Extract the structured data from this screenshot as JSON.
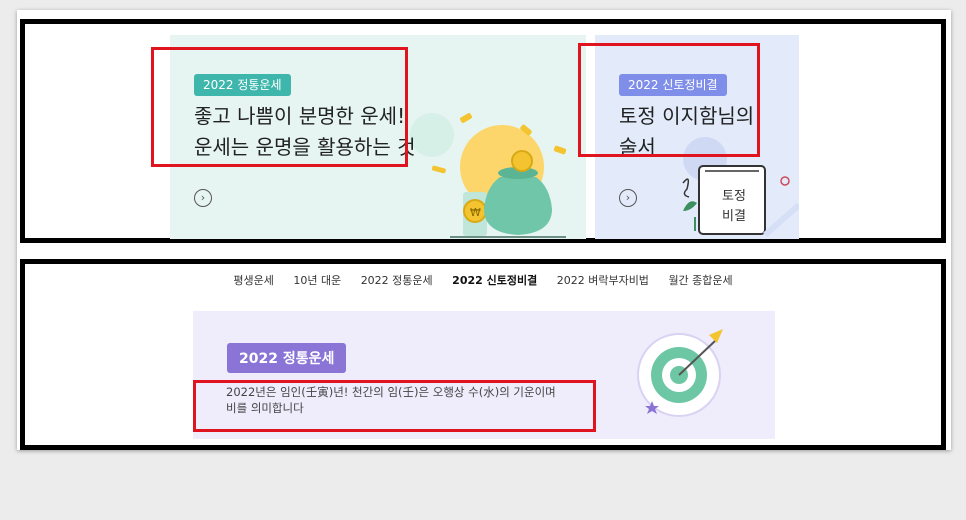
{
  "top_banner": {
    "left_card": {
      "badge": "2022 정통운세",
      "line1": "좋고 나쁨이 분명한 운세!",
      "line2": "운세는 운명을 활용하는 것",
      "arrow": "›"
    },
    "right_card": {
      "badge": "2022 신토정비결",
      "line1": "토정 이지함님의",
      "line2": "술서",
      "book_text_1": "토정",
      "book_text_2": "비결",
      "arrow": "›"
    }
  },
  "nav": {
    "tabs": [
      {
        "label": "평생운세"
      },
      {
        "label": "10년 대운"
      },
      {
        "label": "2022 정통운세"
      },
      {
        "label": "2022 신토정비결"
      },
      {
        "label": "2022 벼락부자비법"
      },
      {
        "label": "월간 종합운세"
      }
    ],
    "active_index": 3
  },
  "bottom_card": {
    "badge": "2022 정통운세",
    "desc_line1": "2022년은 임인(壬寅)년! 천간의 임(壬)은 오행상 수(水)의 기운이며",
    "desc_line2": "비를 의미합니다"
  },
  "colors": {
    "highlight_box": "#e0141e",
    "teal_badge": "#3fb6ac",
    "blue_badge": "#7f8ee8",
    "purple_badge": "#8a74d6"
  }
}
